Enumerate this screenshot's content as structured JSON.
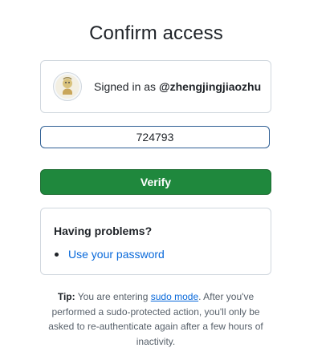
{
  "title": "Confirm access",
  "account": {
    "signed_in_prefix": "Signed in as",
    "username": "@zhengjingjiaozhu"
  },
  "otp_input": {
    "value": "724793"
  },
  "verify_button": {
    "label": "Verify"
  },
  "problems": {
    "title": "Having problems?",
    "links": [
      {
        "label": "Use your password"
      }
    ]
  },
  "tip": {
    "label": "Tip:",
    "text_before": "You are entering",
    "link": "sudo mode",
    "text_after": ". After you've performed a sudo-protected action, you'll only be asked to re-authenticate again after a few hours of inactivity."
  },
  "colors": {
    "primary_button": "#1f883d",
    "link": "#0969da",
    "input_border": "#2f5f94"
  }
}
